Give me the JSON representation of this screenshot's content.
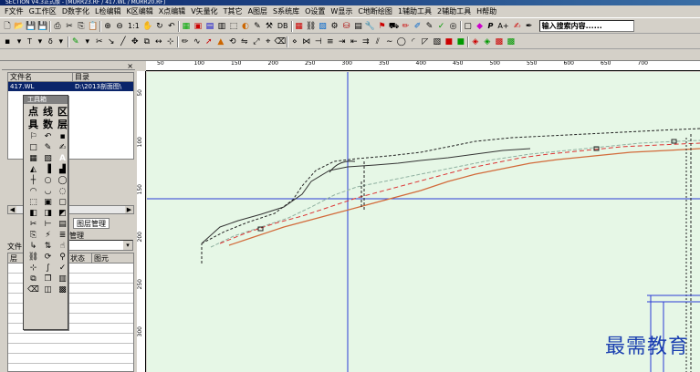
{
  "window": {
    "title": "SECTION V4.3正式版 - [MURR23.RF / 417.WL / MURR20.RF]"
  },
  "menu": [
    "F文件",
    "G工作区",
    "D数字化",
    "L检编辑",
    "K区编辑",
    "X点编辑",
    "V矢量化",
    "T其它",
    "A图层",
    "S系统库",
    "O设置",
    "W显示",
    "C地断绘图",
    "1辅助工具",
    "2辅助工具",
    "H帮助"
  ],
  "toolbar1": {
    "buttons": [
      "new-icon",
      "open-icon",
      "save-icon",
      "saveas-icon",
      "print-icon",
      "cut-icon",
      "copy-icon",
      "paste-icon",
      "zoom-in-icon",
      "zoom-out-icon"
    ],
    "zoom_label": "1:1",
    "text_buttons": [
      "P",
      "A+"
    ],
    "db_label": "DB",
    "search_placeholder": "输入搜索内容......"
  },
  "toolbar2": {
    "labels": [
      "T",
      "δ"
    ]
  },
  "doc": {
    "name": "417.WL"
  },
  "filepanel": {
    "columns": [
      "文件名",
      "目录"
    ],
    "rows": [
      {
        "name": "417.WL",
        "dir": "D:\\2013剖面图\\"
      }
    ],
    "tabs": [
      "图层管理"
    ],
    "layer_title": "图层管理",
    "layer_select_label": "文件",
    "layer_columns": [
      "层",
      "状态",
      "图元"
    ]
  },
  "toolbox": {
    "title": "工具箱",
    "big_buttons": [
      "点",
      "线",
      "区",
      "具",
      "数",
      "层"
    ]
  },
  "ruler": {
    "top_labels": [
      "50",
      "100",
      "150",
      "200",
      "250",
      "300",
      "350",
      "400",
      "450",
      "500",
      "550",
      "600",
      "650",
      "700"
    ],
    "left_labels": [
      "50",
      "100",
      "150",
      "200",
      "250",
      "300"
    ]
  },
  "watermark": "最需教育",
  "colors": {
    "canvas_bg": "#e6f7e6",
    "profile_red": "#d26a3a",
    "crosshair": "#2b3bd6"
  }
}
